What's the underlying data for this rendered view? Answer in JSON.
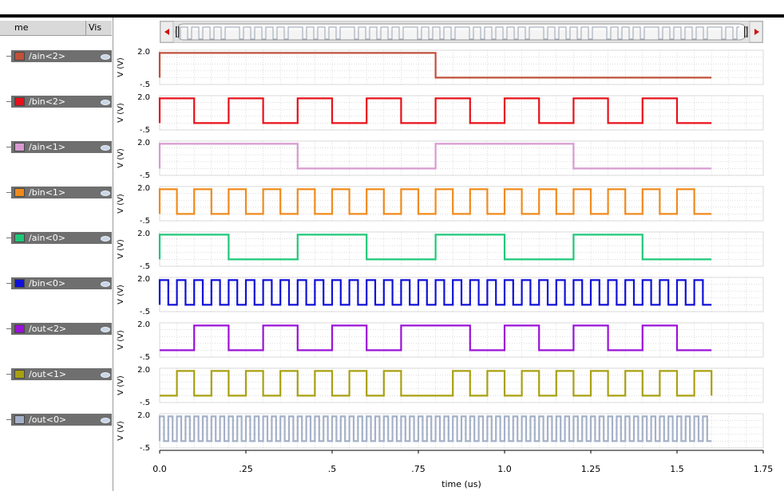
{
  "panel": {
    "col_name": "me",
    "col_vis": "Vis"
  },
  "chart_data": {
    "type": "line",
    "xlabel": "time (us)",
    "ylabel": "V (V)",
    "xlim": [
      0,
      1.75
    ],
    "xticks": [
      "0.0",
      ".25",
      ".5",
      ".75",
      "1.0",
      "1.25",
      "1.5",
      "1.75"
    ],
    "ylim": [
      -0.5,
      2.0
    ],
    "yticks": [
      "2.0",
      "-.5"
    ],
    "grid": true,
    "series": [
      {
        "name": "/ain<2>",
        "color": "#c0503a",
        "x": [
          0,
          0.8,
          1.6
        ],
        "y": [
          1.8,
          0,
          0
        ]
      },
      {
        "name": "/bin<2>",
        "color": "#e8101a",
        "x": [
          0,
          0.1,
          0.2,
          0.3,
          0.4,
          0.5,
          0.6,
          0.7,
          0.8,
          0.9,
          1.0,
          1.1,
          1.2,
          1.3,
          1.4,
          1.5,
          1.6
        ],
        "y": [
          1.8,
          0,
          1.8,
          0,
          1.8,
          0,
          1.8,
          0,
          1.8,
          0,
          1.8,
          0,
          1.8,
          0,
          1.8,
          0,
          0
        ]
      },
      {
        "name": "/ain<1>",
        "color": "#d89ad0",
        "x": [
          0,
          0.4,
          0.8,
          1.2,
          1.6
        ],
        "y": [
          1.8,
          0,
          1.8,
          0,
          0
        ]
      },
      {
        "name": "/bin<1>",
        "color": "#f08a1c",
        "x": [
          0,
          0.05,
          0.1,
          0.15,
          0.2,
          0.25,
          0.3,
          0.35,
          0.4,
          0.45,
          0.5,
          0.55,
          0.6,
          0.65,
          0.7,
          0.75,
          0.8,
          0.85,
          0.9,
          0.95,
          1.0,
          1.05,
          1.1,
          1.15,
          1.2,
          1.25,
          1.3,
          1.35,
          1.4,
          1.45,
          1.5,
          1.55,
          1.6
        ],
        "y": [
          1.8,
          0,
          1.8,
          0,
          1.8,
          0,
          1.8,
          0,
          1.8,
          0,
          1.8,
          0,
          1.8,
          0,
          1.8,
          0,
          1.8,
          0,
          1.8,
          0,
          1.8,
          0,
          1.8,
          0,
          1.8,
          0,
          1.8,
          0,
          1.8,
          0,
          1.8,
          0,
          0
        ]
      },
      {
        "name": "/ain<0>",
        "color": "#1ec878",
        "x": [
          0,
          0.2,
          0.4,
          0.6,
          0.8,
          1.0,
          1.2,
          1.4,
          1.6
        ],
        "y": [
          1.8,
          0,
          1.8,
          0,
          1.8,
          0,
          1.8,
          0,
          0
        ]
      },
      {
        "name": "/bin<0>",
        "color": "#1010d8",
        "period": 0.05,
        "x": [
          0,
          1.6
        ],
        "y": [
          1.8,
          0
        ]
      },
      {
        "name": "/out<2>",
        "color": "#9a12d8",
        "x": [
          0,
          0.1,
          0.2,
          0.3,
          0.4,
          0.5,
          0.6,
          0.7,
          0.9,
          1.0,
          1.1,
          1.2,
          1.3,
          1.4,
          1.5,
          1.6
        ],
        "y": [
          0,
          1.8,
          0,
          1.8,
          0,
          1.8,
          0,
          1.8,
          0,
          1.8,
          0,
          1.8,
          0,
          1.8,
          0,
          0
        ]
      },
      {
        "name": "/out<1>",
        "color": "#a8a010",
        "x": [
          0,
          0.05,
          0.1,
          0.15,
          0.2,
          0.25,
          0.3,
          0.35,
          0.4,
          0.45,
          0.5,
          0.55,
          0.6,
          0.65,
          0.7,
          0.85,
          0.9,
          0.95,
          1.0,
          1.05,
          1.1,
          1.15,
          1.2,
          1.25,
          1.3,
          1.35,
          1.4,
          1.45,
          1.5,
          1.55,
          1.6
        ],
        "y": [
          0,
          1.8,
          0,
          1.8,
          0,
          1.8,
          0,
          1.8,
          0,
          1.8,
          0,
          1.8,
          0,
          1.8,
          0,
          1.8,
          0,
          1.8,
          0,
          1.8,
          0,
          1.8,
          0,
          1.8,
          0,
          1.8,
          0,
          1.8,
          0,
          1.8,
          0
        ]
      },
      {
        "name": "/out<0>",
        "color": "#a4b0c8",
        "period": 0.025,
        "x": [
          0,
          1.6
        ],
        "y": [
          1.8,
          0
        ]
      }
    ]
  }
}
